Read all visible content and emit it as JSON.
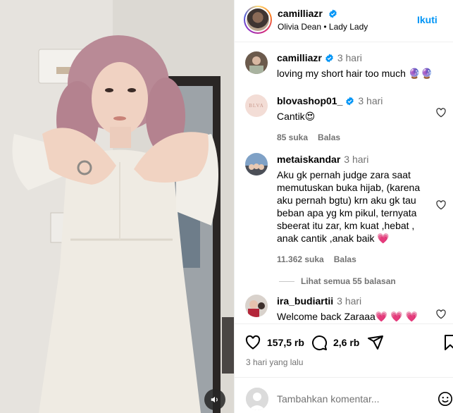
{
  "post": {
    "username": "camilliazr",
    "song": "Olivia Dean • Lady Lady",
    "follow_label": "Ikuti",
    "more_label": "•••",
    "caption": {
      "username": "camilliazr",
      "time": "3 hari",
      "text": "loving my short hair too much 🔮🔮"
    }
  },
  "comments": [
    {
      "username": "blovashop01_",
      "verified": true,
      "time": "3 hari",
      "text": "Cantik😍",
      "likes": "85 suka",
      "reply_label": "Balas",
      "avatar_text": "BLVA"
    },
    {
      "username": "metaiskandar",
      "verified": false,
      "time": "3 hari",
      "text": "Aku gk pernah judge zara saat memutuskan buka hijab, (karena aku pernah bgtu) krn aku gk tau beban apa yg km pikul, ternyata sbeerat itu zar, km kuat ,hebat , anak cantik ,anak baik 💗",
      "likes": "11.362 suka",
      "reply_label": "Balas"
    },
    {
      "username": "ira_budiartii",
      "verified": false,
      "time": "3 hari",
      "text": "Welcome back Zaraaa💗 💗 💗"
    }
  ],
  "view_replies": "Lihat semua 55 balasan",
  "actions": {
    "likes_count": "157,5 rb",
    "comments_count": "2,6 rb",
    "posted_time": "3 hari yang lalu"
  },
  "add_comment": {
    "placeholder": "Tambahkan komentar..."
  },
  "colors": {
    "accent": "#0095f6",
    "secondary_text": "#737373",
    "divider": "#efefef"
  },
  "icons": [
    "verified-badge-icon",
    "heart-icon",
    "comment-icon",
    "share-icon",
    "bookmark-icon",
    "mute-icon",
    "emoji-icon",
    "more-icon"
  ]
}
